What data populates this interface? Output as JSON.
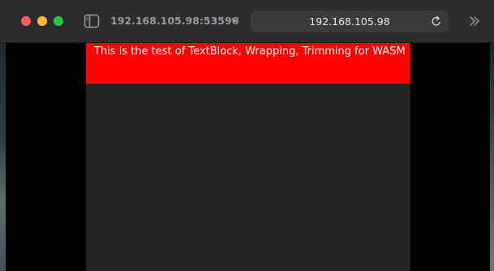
{
  "browser": {
    "host_label": "192.168.105.98:53596",
    "url": "192.168.105.98"
  },
  "icons": {
    "sidebar": "sidebar-icon",
    "host_menu": "chevron-down-icon",
    "reload": "reload-icon",
    "more": "chevron-double-right-icon"
  },
  "page": {
    "textblock": "This is the test of TextBlock, Wrapping, Trimming for WASM"
  },
  "colors": {
    "banner": "#ff0000",
    "page_background": "#222222",
    "traffic_red": "#ff5f57",
    "traffic_yellow": "#febc2e",
    "traffic_green": "#28c840"
  }
}
